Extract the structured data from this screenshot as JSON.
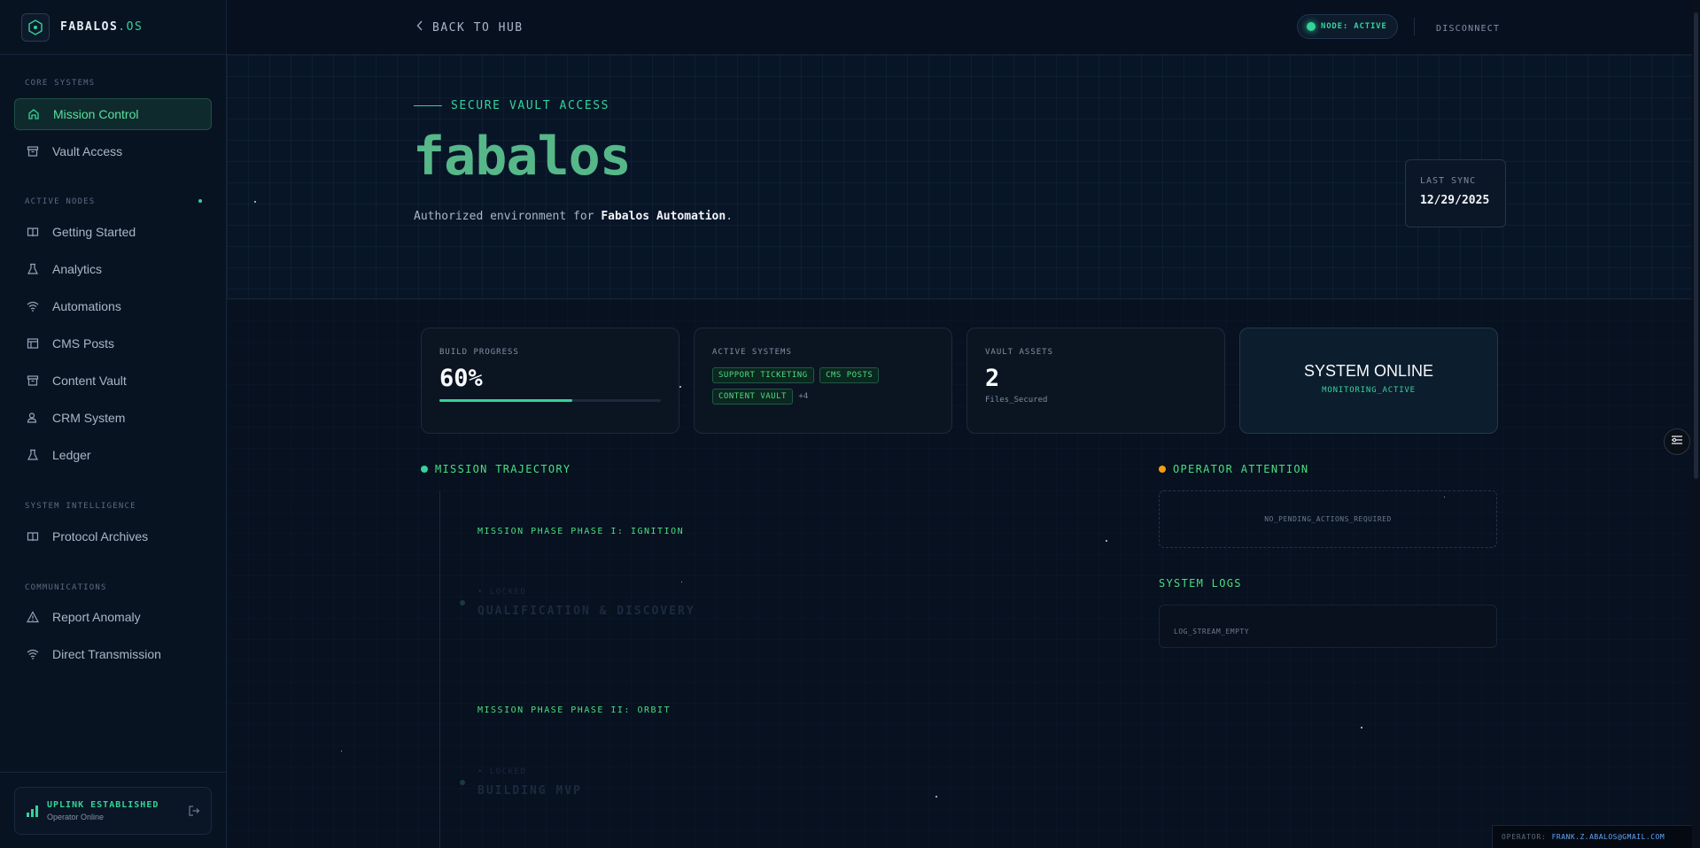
{
  "brand": {
    "name": "FABALOS",
    "suffix": ".OS"
  },
  "sidebar": {
    "sections": [
      {
        "label": "CORE SYSTEMS"
      },
      {
        "label": "ACTIVE NODES"
      },
      {
        "label": "SYSTEM INTELLIGENCE"
      },
      {
        "label": "COMMUNICATIONS"
      }
    ],
    "items": [
      {
        "label": "Mission Control",
        "icon": "home-icon"
      },
      {
        "label": "Vault Access",
        "icon": "archive-icon"
      },
      {
        "label": "Getting Started",
        "icon": "book-icon"
      },
      {
        "label": "Analytics",
        "icon": "flask-icon"
      },
      {
        "label": "Automations",
        "icon": "wifi-icon"
      },
      {
        "label": "CMS Posts",
        "icon": "layout-icon"
      },
      {
        "label": "Content Vault",
        "icon": "archive-icon"
      },
      {
        "label": "CRM System",
        "icon": "users-icon"
      },
      {
        "label": "Ledger",
        "icon": "flask-icon"
      },
      {
        "label": "Protocol Archives",
        "icon": "book-icon"
      },
      {
        "label": "Report Anomaly",
        "icon": "warning-icon"
      },
      {
        "label": "Direct Transmission",
        "icon": "wifi-icon"
      }
    ],
    "uplink": {
      "title": "UPLINK ESTABLISHED",
      "subtitle": "Operator Online"
    }
  },
  "topbar": {
    "back_label": "BACK TO HUB",
    "node_status": "NODE: ACTIVE",
    "disconnect_label": "DISCONNECT"
  },
  "hero": {
    "kicker": "SECURE VAULT ACCESS",
    "title": "fabalos",
    "desc_prefix": "Authorized environment for ",
    "desc_bold": "Fabalos Automation",
    "desc_suffix": ".",
    "sync_label": "LAST SYNC",
    "sync_date": "12/29/2025"
  },
  "stats": {
    "build_label": "BUILD PROGRESS",
    "build_value": "60%",
    "build_progress": 0.6,
    "systems_label": "ACTIVE SYSTEMS",
    "systems_tags": [
      "SUPPORT TICKETING",
      "CMS POSTS",
      "CONTENT VAULT"
    ],
    "systems_more": "+4",
    "vault_label": "VAULT ASSETS",
    "vault_value": "2",
    "vault_sub": "Files_Secured",
    "status_title": "SYSTEM ONLINE",
    "status_sub": "MONITORING_ACTIVE"
  },
  "trajectory": {
    "title": "MISSION TRAJECTORY",
    "phase1": "MISSION PHASE PHASE I: IGNITION",
    "step1_state": "• LOCKED",
    "step1_title": "QUALIFICATION & DISCOVERY",
    "phase2": "MISSION PHASE PHASE II: ORBIT",
    "step2_state": "• LOCKED",
    "step2_title": "BUILDING MVP"
  },
  "attention": {
    "title": "OPERATOR ATTENTION",
    "empty": "NO_PENDING_ACTIONS_REQUIRED"
  },
  "logs": {
    "title": "SYSTEM LOGS",
    "empty": "LOG_STREAM_EMPTY"
  },
  "footer": {
    "operator_label": "OPERATOR:",
    "operator_email": "FRANK.Z.ABALOS@GMAIL.COM"
  },
  "colors": {
    "accent": "#34d399",
    "warning": "#f59e0b",
    "background": "#07101f"
  }
}
